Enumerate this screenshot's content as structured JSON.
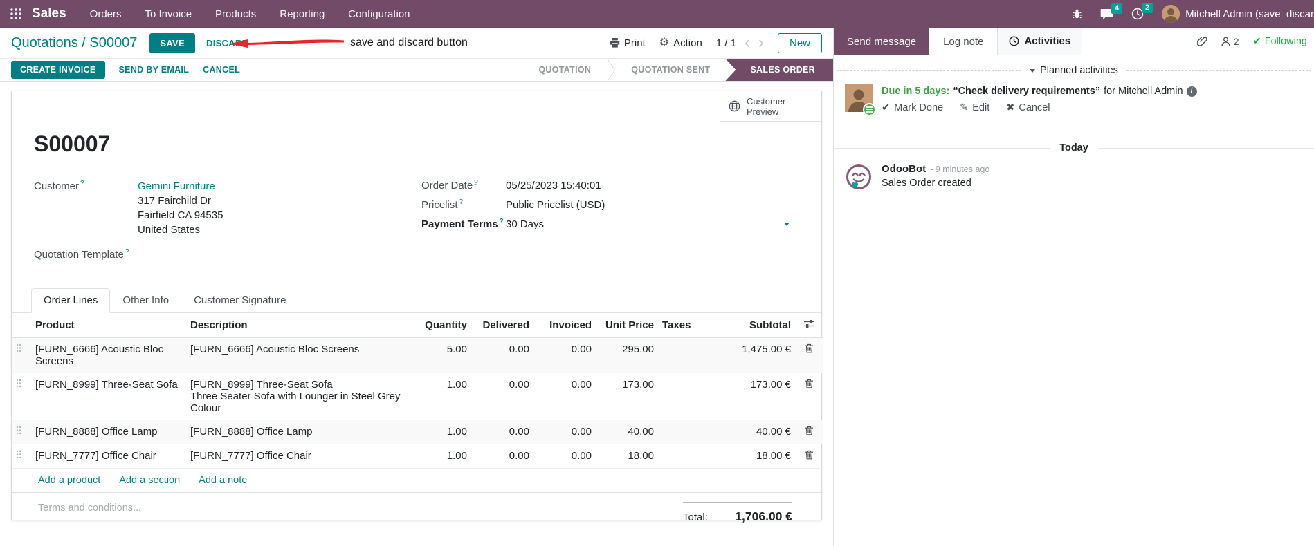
{
  "colors": {
    "topbar_purple": "#714B67",
    "accent_teal": "#017E84",
    "badge_teal": "#00A09D",
    "edited_blue": "#0b87c4",
    "green": "#28a745",
    "annotation_red": "#e8242c"
  },
  "icons": {
    "gear": "⚙",
    "check": "✔",
    "pencil": "✎",
    "cross": "✖",
    "pager_prev": "‹",
    "pager_next": "›",
    "info": "i"
  },
  "topbar": {
    "brand": "Sales",
    "menus": [
      "Orders",
      "To Invoice",
      "Products",
      "Reporting",
      "Configuration"
    ],
    "message_badge": "4",
    "activity_badge": "2",
    "user_name": "Mitchell Admin (save_discar"
  },
  "control_bar": {
    "breadcrumb": "Quotations / S00007",
    "save": "SAVE",
    "discard": "DISCARD",
    "annotation": "save and discard button",
    "print": "Print",
    "action": "Action",
    "pager": "1 / 1",
    "new": "New"
  },
  "status_bar": {
    "create_invoice": "CREATE INVOICE",
    "send_by_email": "SEND BY EMAIL",
    "cancel": "CANCEL",
    "stages": [
      {
        "label": "QUOTATION",
        "active": false
      },
      {
        "label": "QUOTATION SENT",
        "active": false
      },
      {
        "label": "SALES ORDER",
        "active": true
      }
    ]
  },
  "form": {
    "preview_line1": "Customer",
    "preview_line2": "Preview",
    "title": "S00007",
    "fields": {
      "customer_label": "Customer",
      "customer_name": "Gemini Furniture",
      "address_line1": "317 Fairchild Dr",
      "address_line2": "Fairfield CA 94535",
      "address_line3": "United States",
      "quotation_template_label": "Quotation Template",
      "order_date_label": "Order Date",
      "order_date": "05/25/2023 15:40:01",
      "pricelist_label": "Pricelist",
      "pricelist": "Public Pricelist (USD)",
      "payment_terms_label": "Payment Terms",
      "payment_terms": "30 Days"
    },
    "tabs": [
      {
        "label": "Order Lines"
      },
      {
        "label": "Other Info"
      },
      {
        "label": "Customer Signature"
      }
    ],
    "table": {
      "headers": [
        "Product",
        "Description",
        "Quantity",
        "Delivered",
        "Invoiced",
        "Unit Price",
        "Taxes",
        "Subtotal"
      ],
      "rows": [
        {
          "product": "[FURN_6666] Acoustic Bloc Screens",
          "description": [
            "[FURN_6666] Acoustic Bloc Screens"
          ],
          "quantity": "5.00",
          "delivered": "0.00",
          "invoiced": "0.00",
          "unit_price": "295.00",
          "subtotal": "1,475.00 €"
        },
        {
          "product": "[FURN_8999] Three-Seat Sofa",
          "description": [
            "[FURN_8999] Three-Seat Sofa",
            "Three Seater Sofa with Lounger in Steel Grey Colour"
          ],
          "quantity": "1.00",
          "delivered": "0.00",
          "invoiced": "0.00",
          "unit_price": "173.00",
          "subtotal": "173.00 €"
        },
        {
          "product": "[FURN_8888] Office Lamp",
          "description": [
            "[FURN_8888] Office Lamp"
          ],
          "quantity": "1.00",
          "delivered": "0.00",
          "invoiced": "0.00",
          "unit_price": "40.00",
          "subtotal": "40.00 €"
        },
        {
          "product": "[FURN_7777] Office Chair",
          "description": [
            "[FURN_7777] Office Chair"
          ],
          "quantity": "1.00",
          "delivered": "0.00",
          "invoiced": "0.00",
          "unit_price": "18.00",
          "subtotal": "18.00 €"
        }
      ],
      "footer_links": [
        "Add a product",
        "Add a section",
        "Add a note"
      ]
    },
    "terms_placeholder": "Terms and conditions...",
    "total_label": "Total:",
    "total_value": "1,706.00 €"
  },
  "chatter": {
    "send_message": "Send message",
    "log_note": "Log note",
    "activities": "Activities",
    "follower_count": "2",
    "following": "Following",
    "planned_activities": "Planned activities",
    "activity": {
      "due": "Due in 5 days:",
      "title": "“Check delivery requirements”",
      "assignee": "for Mitchell Admin",
      "mark_done": "Mark Done",
      "edit": "Edit",
      "cancel": "Cancel"
    },
    "today": "Today",
    "message": {
      "author": "OdooBot",
      "time": "- 9 minutes ago",
      "body": "Sales Order created"
    }
  }
}
